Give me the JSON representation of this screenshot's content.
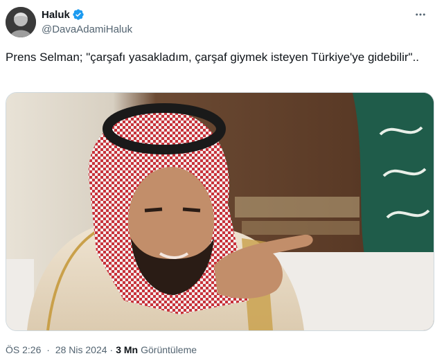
{
  "author": {
    "display_name": "Haluk",
    "handle": "@DavaAdamiHaluk",
    "verified": true
  },
  "tweet": {
    "text": "Prens Selman; \"çarşafı yasakladım, çarşaf giymek isteyen Türkiye'ye gidebilir\".."
  },
  "meta": {
    "time": "ÖS 2:26",
    "separator": "·",
    "date": "28 Nis 2024",
    "views_count": "3 Mn",
    "views_label": "Görüntüleme"
  },
  "colors": {
    "verified": "#1d9bf0",
    "secondary_text": "#536471"
  },
  "icons": {
    "verified": "verified-badge-icon",
    "more": "more-options-icon"
  }
}
